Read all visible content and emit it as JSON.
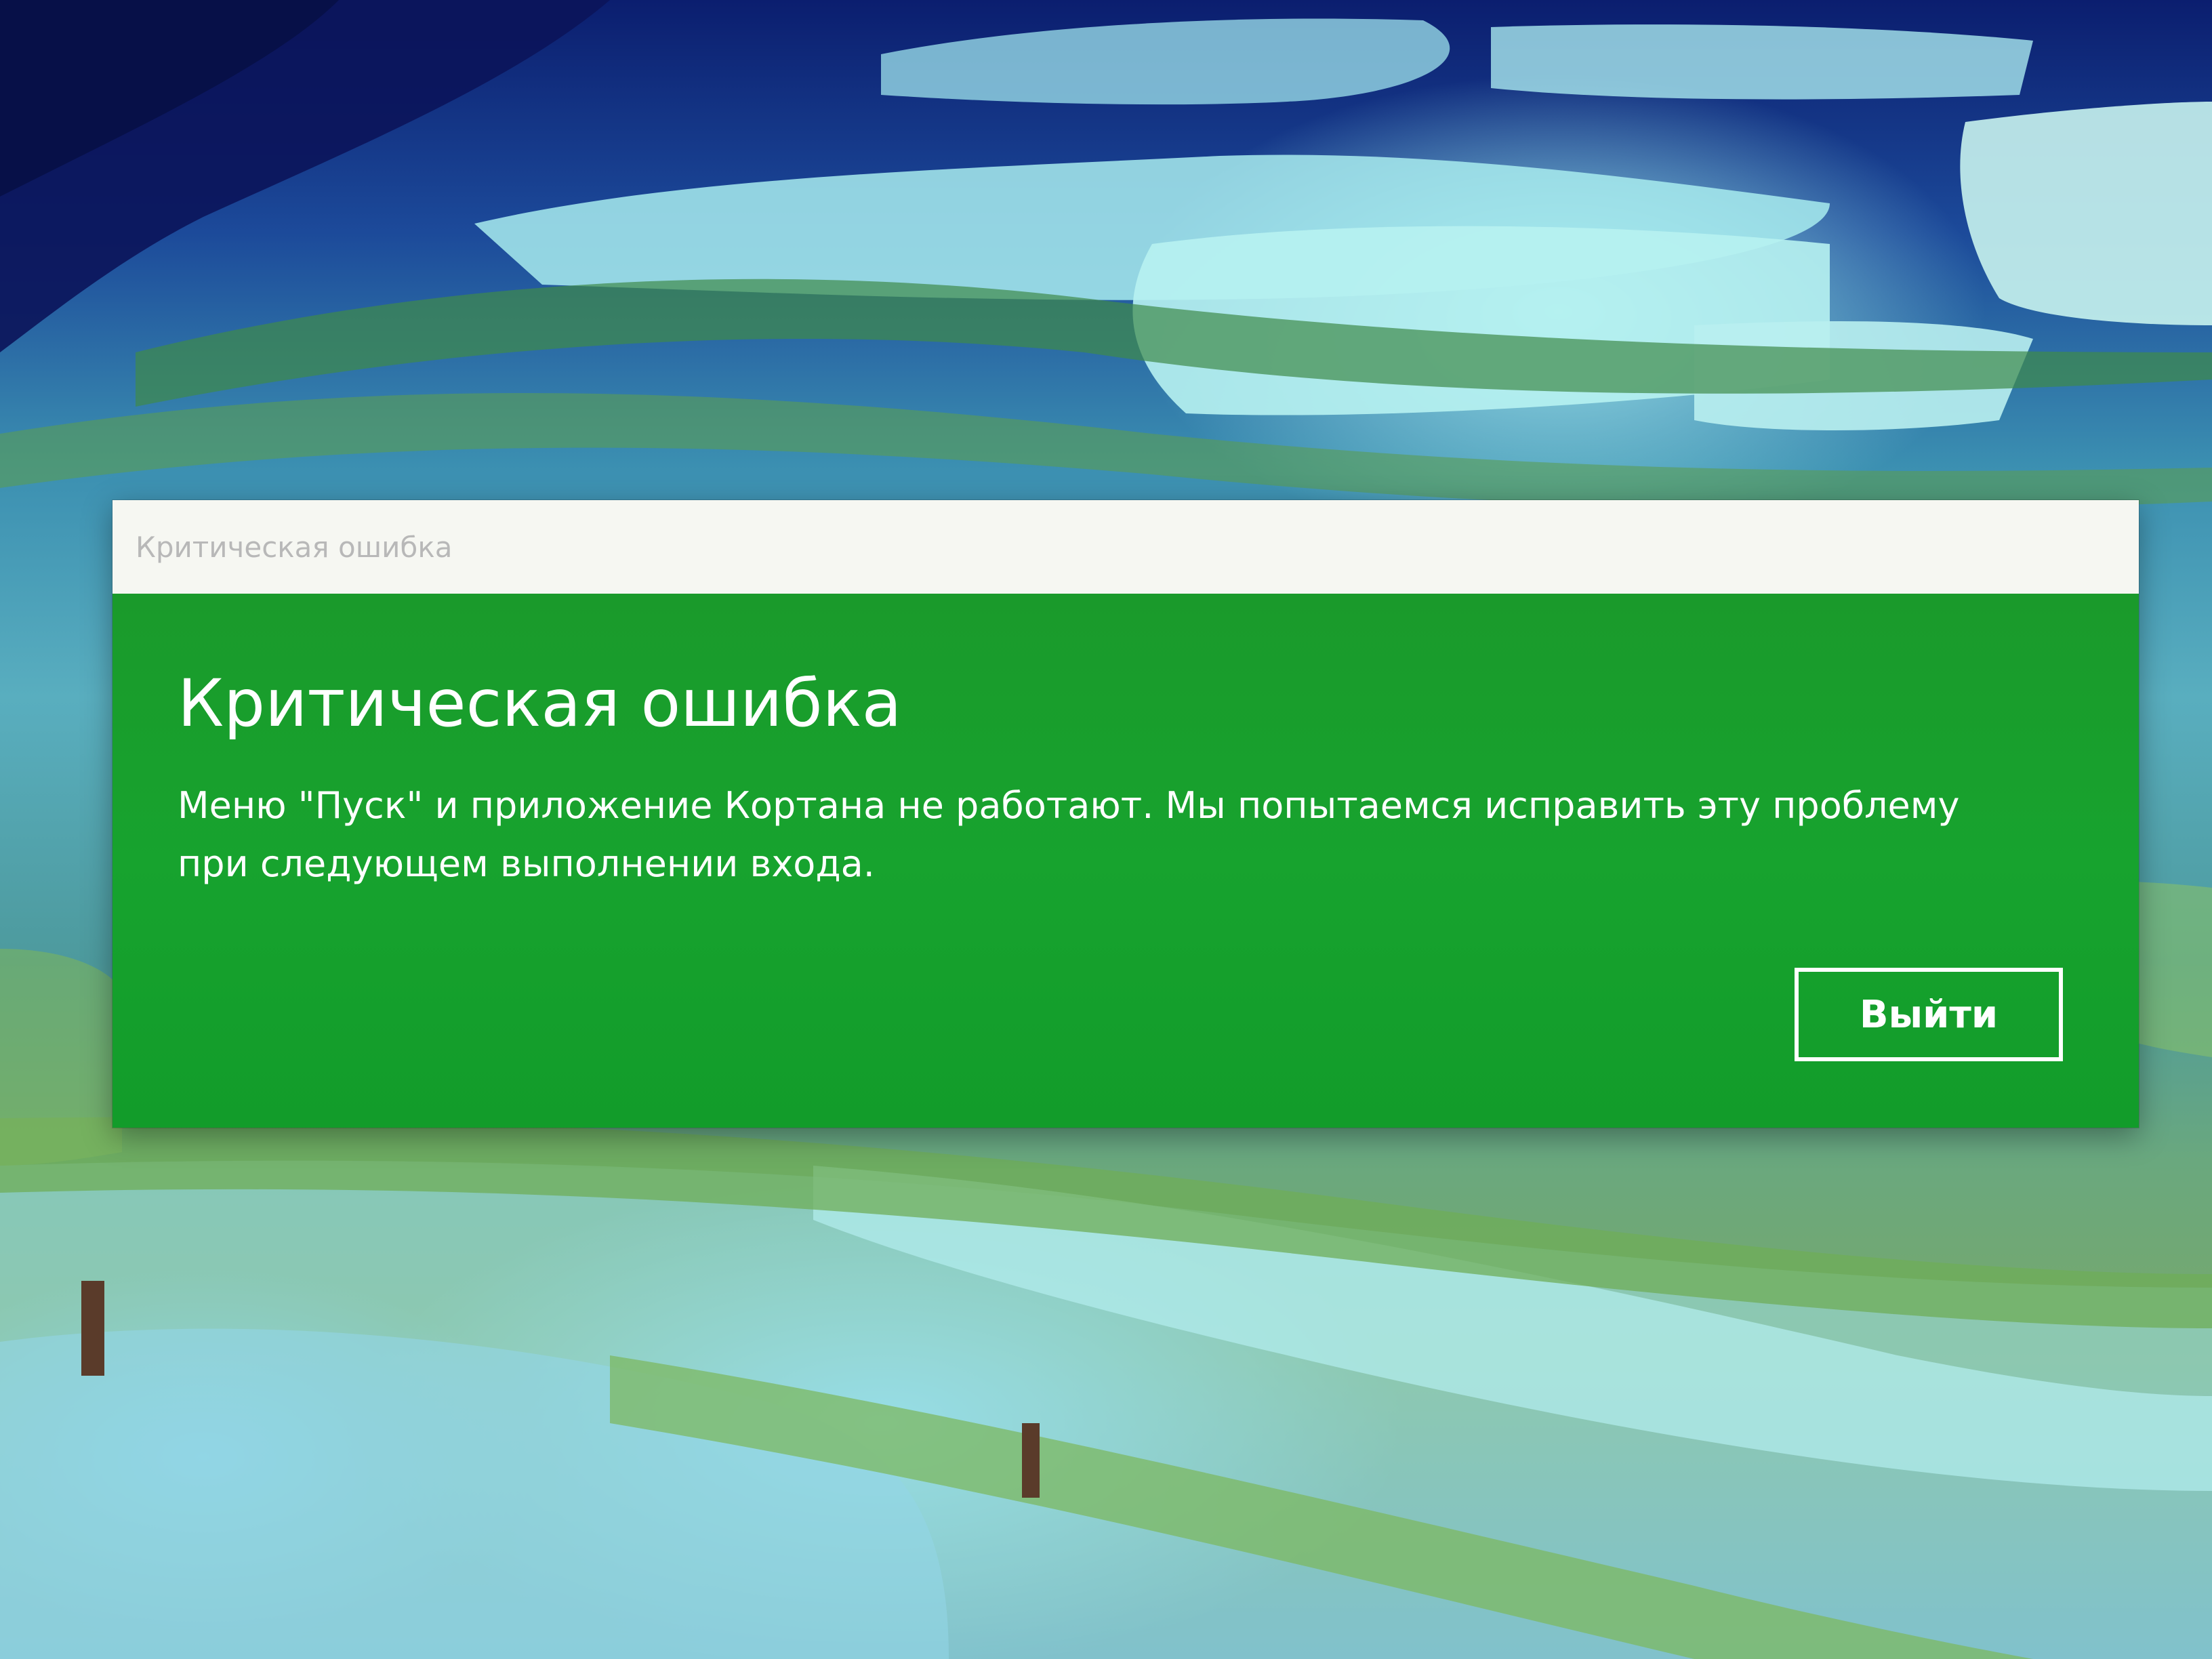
{
  "window": {
    "title": "Критическая ошибка"
  },
  "dialog": {
    "heading": "Критическая ошибка",
    "message": "Меню \"Пуск\" и приложение Кортана не работают. Мы попытаемся исправить эту проблему при следующем выполнении входа.",
    "exit_button_label": "Выйти"
  },
  "colors": {
    "dialog_background": "#17a32e",
    "titlebar_background": "#f6f7f2",
    "text": "#ffffff"
  }
}
